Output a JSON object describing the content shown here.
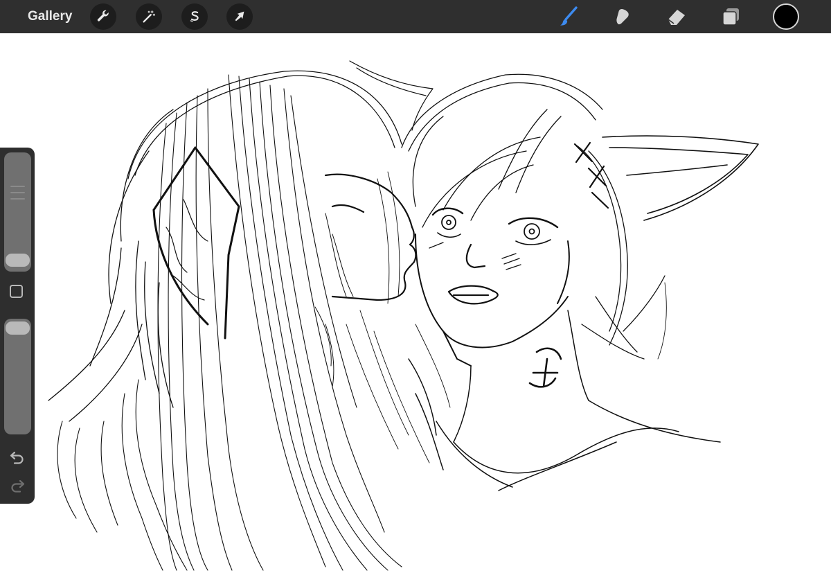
{
  "toolbar": {
    "gallery_label": "Gallery",
    "left_tools": [
      {
        "name": "actions",
        "icon": "wrench-icon"
      },
      {
        "name": "adjustments",
        "icon": "magic-wand-icon"
      },
      {
        "name": "selection",
        "icon": "selection-s-icon"
      },
      {
        "name": "transform",
        "icon": "arrow-cursor-icon"
      }
    ],
    "right_tools": [
      {
        "name": "brush",
        "icon": "brush-icon",
        "active": true
      },
      {
        "name": "smudge",
        "icon": "smudge-finger-icon",
        "active": false
      },
      {
        "name": "eraser",
        "icon": "eraser-icon",
        "active": false
      },
      {
        "name": "layers",
        "icon": "layers-icon",
        "active": false
      }
    ],
    "current_color": "#000000"
  },
  "sidebar": {
    "brush_size_level": 0.05,
    "brush_opacity_level": 0.95,
    "modify_button_icon": "square-icon",
    "undo_icon": "undo-icon",
    "redo_icon": "redo-icon"
  },
  "colors": {
    "toolbar_bg": "#2f2f2f",
    "sidebar_bg": "#2e2e2e",
    "active_tool": "#3d8bf0",
    "inactive_tool": "#d6d6d6",
    "canvas_bg": "#ffffff",
    "ink": "#111111"
  },
  "canvas": {
    "content": "line-art-sketch"
  }
}
